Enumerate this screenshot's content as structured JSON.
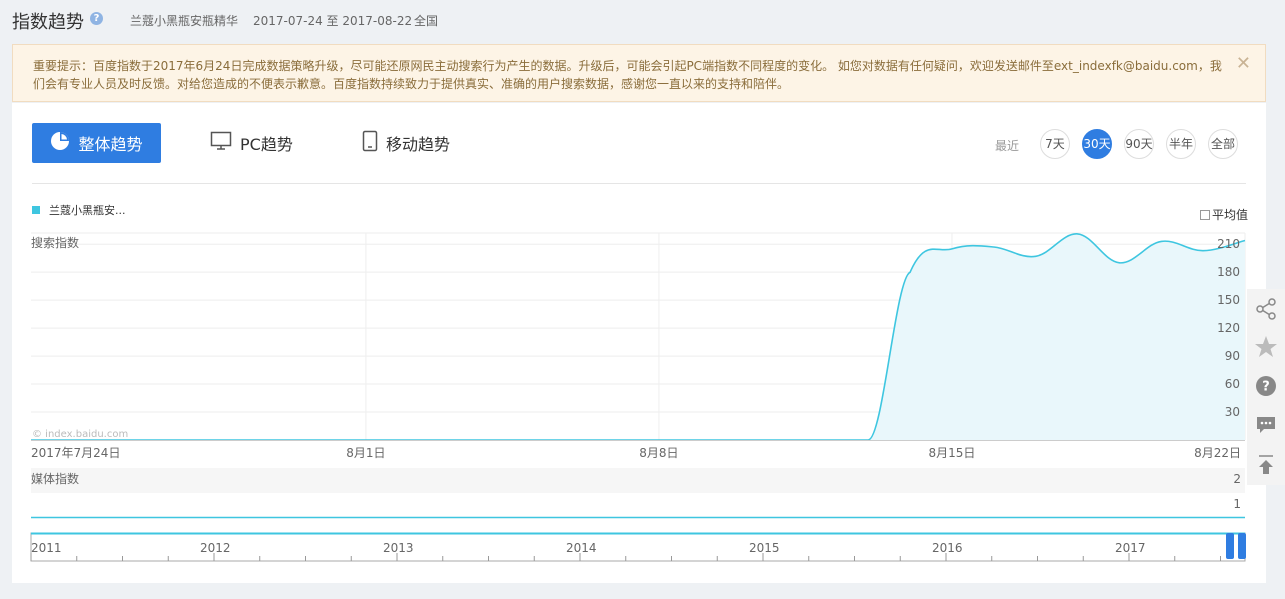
{
  "header": {
    "title": "指数趋势",
    "help_icon": "question-icon",
    "keyword": "兰蔻小黑瓶安瓶精华",
    "date_range": "2017-07-24 至 2017-08-22",
    "region": "全国"
  },
  "notice": {
    "text": "重要提示：百度指数于2017年6月24日完成数据策略升级，尽可能还原网民主动搜索行为产生的数据。升级后，可能会引起PC端指数不同程度的变化。 如您对数据有任何疑问，欢迎发送邮件至ext_indexfk@baidu.com，我们会有专业人员及时反馈。对给您造成的不便表示歉意。百度指数持续致力于提供真实、准确的用户搜索数据，感谢您一直以来的支持和陪伴。",
    "close_icon": "close-icon"
  },
  "tabs": [
    {
      "label": "整体趋势",
      "icon": "pie-chart-icon",
      "active": true
    },
    {
      "label": "PC趋势",
      "icon": "monitor-icon",
      "active": false
    },
    {
      "label": "移动趋势",
      "icon": "mobile-icon",
      "active": false
    }
  ],
  "range": {
    "label": "最近",
    "options": [
      "7天",
      "30天",
      "90天",
      "半年",
      "全部"
    ],
    "selected": "30天"
  },
  "legend": {
    "series_name": "兰蔻小黑瓶安...",
    "color": "#3ec6e0"
  },
  "average_toggle": {
    "label": "平均值",
    "checked": false
  },
  "watermark": "© index.baidu.com",
  "colors": {
    "accent": "#2f7de1",
    "line": "#3ec6e0",
    "fill": "#e9f7fb"
  },
  "chart_data": [
    {
      "type": "area",
      "title": "搜索指数",
      "x": [
        "2017-07-24",
        "2017-07-25",
        "2017-07-26",
        "2017-07-27",
        "2017-07-28",
        "2017-07-29",
        "2017-07-30",
        "2017-07-31",
        "2017-08-01",
        "2017-08-02",
        "2017-08-03",
        "2017-08-04",
        "2017-08-05",
        "2017-08-06",
        "2017-08-07",
        "2017-08-08",
        "2017-08-09",
        "2017-08-10",
        "2017-08-11",
        "2017-08-12",
        "2017-08-13",
        "2017-08-14",
        "2017-08-15",
        "2017-08-16",
        "2017-08-17",
        "2017-08-18",
        "2017-08-19",
        "2017-08-20",
        "2017-08-21",
        "2017-08-22"
      ],
      "x_tick_labels": [
        "2017年7月24日",
        "8月1日",
        "8月8日",
        "8月15日",
        "8月22日"
      ],
      "series": [
        {
          "name": "兰蔻小黑瓶安...",
          "values": [
            0,
            0,
            0,
            0,
            0,
            0,
            0,
            0,
            0,
            0,
            0,
            0,
            0,
            0,
            0,
            0,
            0,
            0,
            0,
            0,
            0,
            180,
            205,
            207,
            197,
            221,
            190,
            213,
            203,
            214
          ]
        }
      ],
      "y_ticks": [
        30,
        60,
        90,
        120,
        150,
        180,
        210
      ],
      "ylim": [
        0,
        222
      ],
      "grid": true
    },
    {
      "type": "line",
      "title": "媒体指数",
      "y_ticks": [
        1,
        2
      ],
      "series": [
        {
          "name": "",
          "values": [
            0
          ]
        }
      ]
    }
  ],
  "timeline": {
    "years": [
      "2011",
      "2012",
      "2013",
      "2014",
      "2015",
      "2016",
      "2017"
    ]
  },
  "sidebar": {
    "icons": [
      "share-icon",
      "star-icon",
      "help-icon",
      "comment-icon",
      "back-to-top-icon"
    ]
  }
}
